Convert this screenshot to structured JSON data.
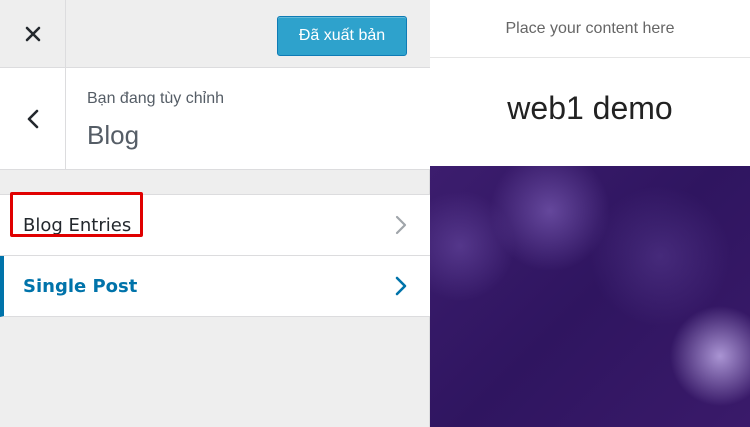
{
  "topbar": {
    "close_icon": "close-icon",
    "publish_label": "Đã xuất bản",
    "publish_color": "#2ea2cc"
  },
  "section": {
    "back_icon": "chevron-left-icon",
    "customizing_label": "Bạn đang tùy chỉnh",
    "title": "Blog"
  },
  "menu": {
    "items": [
      {
        "label": "Blog Entries",
        "icon": "chevron-right-icon",
        "highlighted": true
      },
      {
        "label": "Single Post",
        "icon": "chevron-right-icon",
        "active": true
      }
    ]
  },
  "preview": {
    "top_text": "Place your content here",
    "site_title": "web1 demo"
  },
  "colors": {
    "accent": "#0073aa",
    "highlight_box": "#e00000",
    "hero": "#2f1560"
  }
}
